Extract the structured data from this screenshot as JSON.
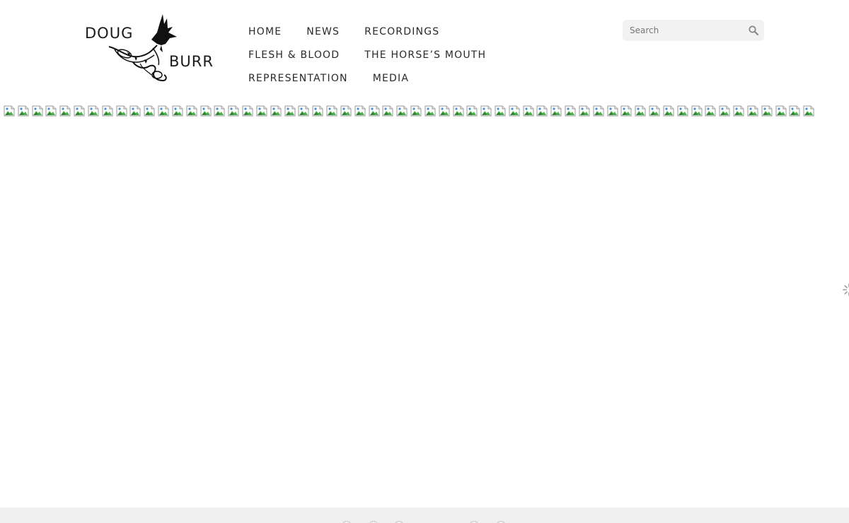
{
  "header": {
    "logo": {
      "line1": "DOUG",
      "line2": "BURR",
      "icon": "bird-and-violin-logo"
    }
  },
  "nav": {
    "rows": [
      [
        {
          "label": "HOME"
        },
        {
          "label": "NEWS"
        },
        {
          "label": "RECORDINGS"
        }
      ],
      [
        {
          "label": "FLESH & BLOOD"
        },
        {
          "label": "THE HORSE’S MOUTH"
        }
      ],
      [
        {
          "label": "REPRESENTATION"
        },
        {
          "label": "MEDIA"
        }
      ]
    ]
  },
  "search": {
    "placeholder": "Search",
    "icon": "search-icon"
  },
  "gallery": {
    "broken_image_count": 58,
    "icon": "broken-image-icon"
  },
  "loading": {
    "icon": "loading-spinner-icon"
  },
  "footer": {
    "icons": [
      "social-icon",
      "social-icon",
      "social-icon",
      "social-icon",
      "social-icon"
    ]
  },
  "colors": {
    "text": "#2a2a2a",
    "search_bg": "#f2f2f2",
    "footer_bg": "#f0f0f0"
  }
}
